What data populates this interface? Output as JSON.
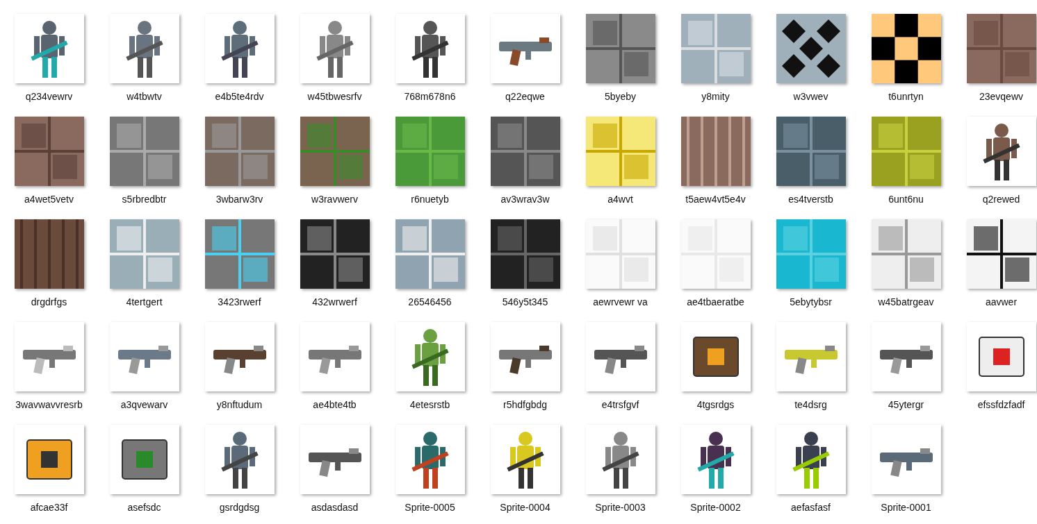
{
  "files": [
    {
      "name": "q234vewrv"
    },
    {
      "name": "w4tbwtv"
    },
    {
      "name": "e4b5te4rdv"
    },
    {
      "name": "w45tbwesrfv"
    },
    {
      "name": "768m678n6"
    },
    {
      "name": "q22eqwe"
    },
    {
      "name": "5byeby"
    },
    {
      "name": "y8mity"
    },
    {
      "name": "w3vwev"
    },
    {
      "name": "t6unrtyn"
    },
    {
      "name": "23evqewv"
    },
    {
      "name": "a4wet5vetv"
    },
    {
      "name": "s5rbredbtr"
    },
    {
      "name": "3wbarw3rv"
    },
    {
      "name": "w3ravwerv"
    },
    {
      "name": "r6nuetyb"
    },
    {
      "name": "av3wrav3w"
    },
    {
      "name": "a4wvt"
    },
    {
      "name": "t5aew4vt5e4v"
    },
    {
      "name": "es4tverstb"
    },
    {
      "name": "6unt6nu"
    },
    {
      "name": "q2rewed"
    },
    {
      "name": "drgdrfgs"
    },
    {
      "name": "4tertgert"
    },
    {
      "name": "3423rwerf"
    },
    {
      "name": "432wrwerf"
    },
    {
      "name": "26546456"
    },
    {
      "name": "546y5t345"
    },
    {
      "name": "aewrvewr va"
    },
    {
      "name": "ae4tbaeratbe"
    },
    {
      "name": "5ebytybsr"
    },
    {
      "name": "w45batrgeav"
    },
    {
      "name": "aavwer"
    },
    {
      "name": "3wavwavvresrb"
    },
    {
      "name": "a3qvewarv"
    },
    {
      "name": "y8nftudum"
    },
    {
      "name": "ae4bte4tb"
    },
    {
      "name": "4etesrstb"
    },
    {
      "name": "r5hdfgbdg"
    },
    {
      "name": "e4trsfgvf"
    },
    {
      "name": "4tgsrdgs"
    },
    {
      "name": "te4dsrg"
    },
    {
      "name": "45ytergr"
    },
    {
      "name": "efssfdzfadf"
    },
    {
      "name": "afcae33f"
    },
    {
      "name": "asefsdc"
    },
    {
      "name": "gsrdgdsg"
    },
    {
      "name": "asdasdasd"
    },
    {
      "name": "Sprite-0005"
    },
    {
      "name": "Sprite-0004"
    },
    {
      "name": "Sprite-0003"
    },
    {
      "name": "Sprite-0002"
    },
    {
      "name": "aefasfasf"
    },
    {
      "name": "Sprite-0001"
    }
  ]
}
